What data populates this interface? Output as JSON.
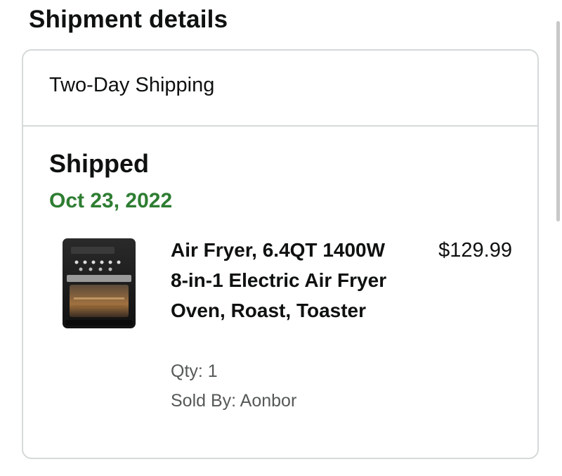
{
  "page": {
    "heading": "Shipment details"
  },
  "shipment": {
    "shipping_method": "Two-Day Shipping",
    "status": "Shipped",
    "date": "Oct 23, 2022",
    "status_color": "#2e7d32"
  },
  "item": {
    "title": "Air Fryer, 6.4QT 1400W 8-in-1 Electric Air Fryer Oven, Roast, Toaster",
    "price": "$129.99",
    "qty": "Qty: 1",
    "sold_by": "Sold By: Aonbor",
    "image_icon": "air-fryer-oven"
  }
}
